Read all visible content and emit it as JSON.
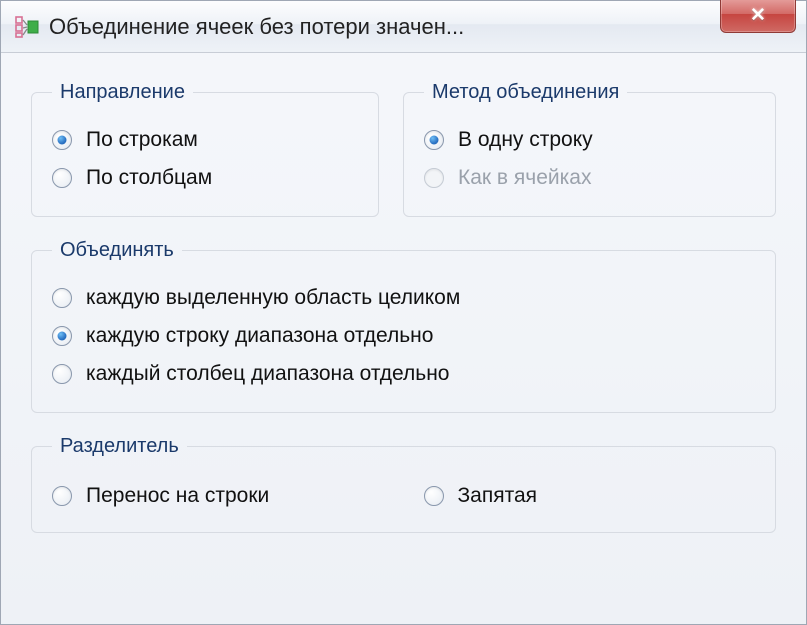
{
  "window": {
    "title": "Объединение ячеек без потери значен..."
  },
  "groups": {
    "direction": {
      "legend": "Направление",
      "options": {
        "rows": "По строкам",
        "cols": "По столбцам"
      },
      "selected": "rows"
    },
    "method": {
      "legend": "Метод объединения",
      "options": {
        "oneline": "В одну строку",
        "ascells": "Как в ячейках"
      },
      "selected": "oneline",
      "disabled": [
        "ascells"
      ]
    },
    "merge": {
      "legend": "Объединять",
      "options": {
        "whole": "каждую выделенную область целиком",
        "eachrow": "каждую строку диапазона отдельно",
        "eachcol": "каждый столбец диапазона отдельно"
      },
      "selected": "eachrow"
    },
    "separator": {
      "legend": "Разделитель",
      "options": {
        "linebreak": "Перенос на строки",
        "comma": "Запятая"
      },
      "selected": null
    }
  }
}
